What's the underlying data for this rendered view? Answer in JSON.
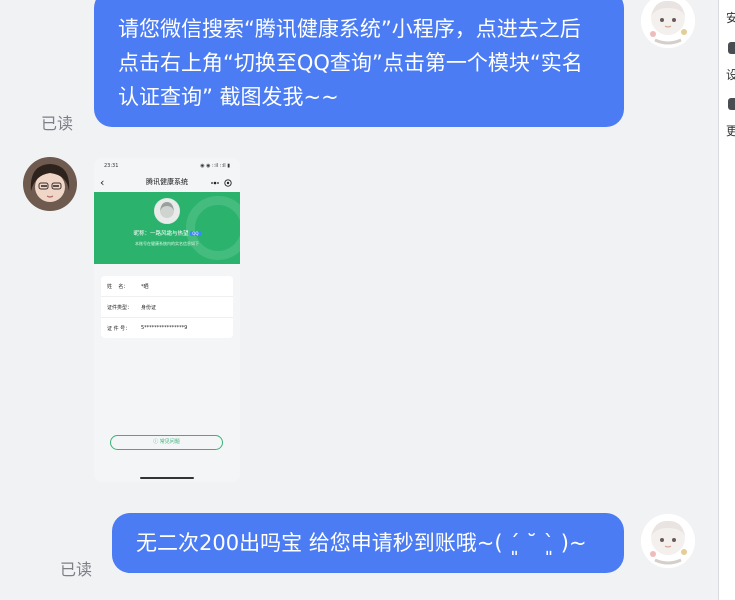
{
  "messages": [
    {
      "text": "请您微信搜索“腾讯健康系统”小程序，点进去之后点击右上角“切换至QQ查询”点击第一个模块“实名认证查询” 截图发我~~",
      "status": "已读"
    },
    {
      "text": "无二次200出吗宝 给您申请秒到账哦~( ˊ͈ ˘ ˋ͈ )~",
      "status": "已读"
    }
  ],
  "screenshot": {
    "status_time": "23:31",
    "status_icons": "◉ ◉ ∷il ∷il ▮",
    "back": "‹",
    "title": "腾讯健康系统",
    "nickname": "昵称：一路风霜与热望",
    "badge": "QQ",
    "subtitle": "本账号在健康系统内的实名信息如下",
    "rows": [
      {
        "label": "姓    名：",
        "value": "*晒"
      },
      {
        "label": "证件类型：",
        "value": "身份证"
      },
      {
        "label": "证 件 号：",
        "value": "5****************9"
      }
    ],
    "faq": "ⓘ 常见问题"
  },
  "sidebar": {
    "items": [
      "安",
      "设",
      "更"
    ]
  },
  "colors": {
    "bubble_out": "#4b7cf3",
    "chat_bg": "#f1f2f4",
    "health_green": "#2bb36d"
  }
}
